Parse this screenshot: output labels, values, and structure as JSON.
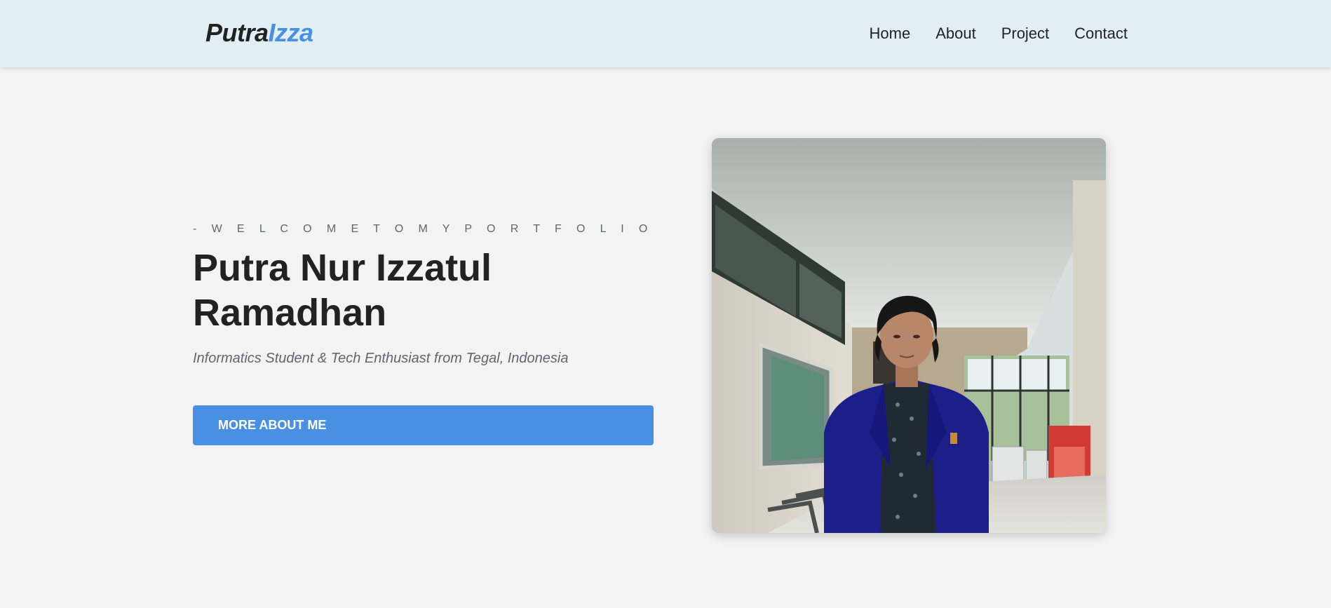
{
  "navbar": {
    "logo": {
      "part1": "Putra",
      "part2": "Izza"
    },
    "links": [
      {
        "label": "Home"
      },
      {
        "label": "About"
      },
      {
        "label": "Project"
      },
      {
        "label": "Contact"
      }
    ]
  },
  "hero": {
    "eyebrow": "- W E L C O M E   T O   M Y   P O R T F O L I O",
    "title_line1": "Putra Nur Izzatul",
    "title_line2": "Ramadhan",
    "subtitle": "Informatics Student & Tech Enthusiast from Tegal, Indonesia",
    "cta_label": "MORE ABOUT ME",
    "photo": {
      "kind": "portrait-photo"
    }
  },
  "colors": {
    "accent": "#4a90e2",
    "navbar_bg": "#e1eff5",
    "page_bg": "#f3f3f3",
    "text_dark": "#222222",
    "text_muted": "#5f6670"
  }
}
